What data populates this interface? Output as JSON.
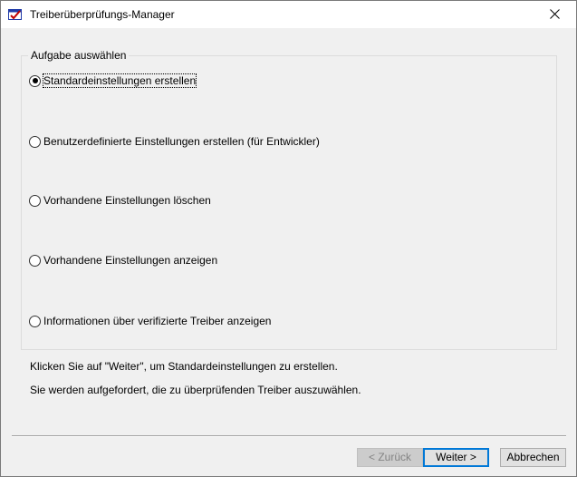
{
  "window": {
    "title": "Treiberüberprüfungs-Manager",
    "icon": "driver-verifier-app-icon",
    "close_icon": "close-icon"
  },
  "group": {
    "label": "Aufgabe auswählen",
    "options": [
      {
        "label": "Standardeinstellungen erstellen",
        "selected": true
      },
      {
        "label": "Benutzerdefinierte Einstellungen erstellen (für Entwickler)",
        "selected": false
      },
      {
        "label": "Vorhandene Einstellungen löschen",
        "selected": false
      },
      {
        "label": "Vorhandene Einstellungen anzeigen",
        "selected": false
      },
      {
        "label": "Informationen über verifizierte Treiber anzeigen",
        "selected": false
      }
    ]
  },
  "info": {
    "line1": "Klicken Sie auf \"Weiter\", um Standardeinstellungen zu erstellen.",
    "line2": "Sie werden aufgefordert, die zu überprüfenden Treiber auszuwählen."
  },
  "buttons": {
    "back": "< Zurück",
    "next": "Weiter >",
    "cancel": "Abbrechen"
  },
  "colors": {
    "accent": "#0078d7",
    "window_bg": "#f0f0f0",
    "titlebar_bg": "#ffffff"
  }
}
